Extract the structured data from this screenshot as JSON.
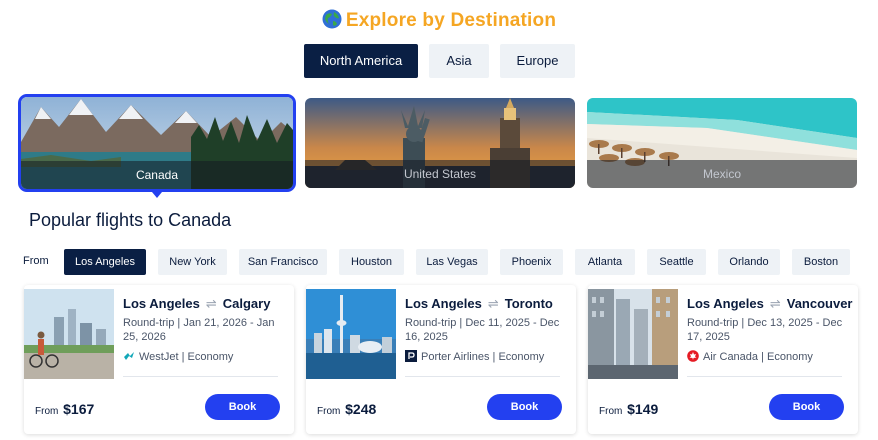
{
  "header": {
    "title": "Explore by Destination",
    "icon": "globe-icon"
  },
  "regions": [
    {
      "label": "North America",
      "active": true
    },
    {
      "label": "Asia",
      "active": false
    },
    {
      "label": "Europe",
      "active": false
    }
  ],
  "destinations": [
    {
      "label": "Canada",
      "active": true
    },
    {
      "label": "United States",
      "active": false
    },
    {
      "label": "Mexico",
      "active": false
    }
  ],
  "section_title": "Popular flights to Canada",
  "from_label": "From",
  "cities": [
    {
      "label": "Los Angeles",
      "active": true
    },
    {
      "label": "New York",
      "active": false
    },
    {
      "label": "San Francisco",
      "active": false
    },
    {
      "label": "Houston",
      "active": false
    },
    {
      "label": "Las Vegas",
      "active": false
    },
    {
      "label": "Phoenix",
      "active": false
    },
    {
      "label": "Atlanta",
      "active": false
    },
    {
      "label": "Seattle",
      "active": false
    },
    {
      "label": "Orlando",
      "active": false
    },
    {
      "label": "Boston",
      "active": false
    }
  ],
  "flights": [
    {
      "origin": "Los Angeles",
      "destination": "Calgary",
      "dates": "Round-trip | Jan 21, 2026 - Jan 25, 2026",
      "airline": "WestJet",
      "cabin": "Economy",
      "airline_text": "WestJet | Economy",
      "airline_icon": "westjet-logo-icon",
      "price_label": "From",
      "price": "$167",
      "book_label": "Book"
    },
    {
      "origin": "Los Angeles",
      "destination": "Toronto",
      "dates": "Round-trip | Dec 11, 2025 - Dec 16, 2025",
      "airline": "Porter Airlines",
      "cabin": "Economy",
      "airline_text": "Porter Airlines | Economy",
      "airline_icon": "porter-logo-icon",
      "price_label": "From",
      "price": "$248",
      "book_label": "Book"
    },
    {
      "origin": "Los Angeles",
      "destination": "Vancouver",
      "dates": "Round-trip | Dec 13, 2025 - Dec 17, 2025",
      "airline": "Air Canada",
      "cabin": "Economy",
      "airline_text": "Air Canada | Economy",
      "airline_icon": "air-canada-logo-icon",
      "price_label": "From",
      "price": "$149",
      "book_label": "Book"
    }
  ],
  "colors": {
    "title": "#f5a623",
    "active_tab": "#0a1f44",
    "inactive_tab": "#eef2f6",
    "accent": "#2340f0"
  }
}
